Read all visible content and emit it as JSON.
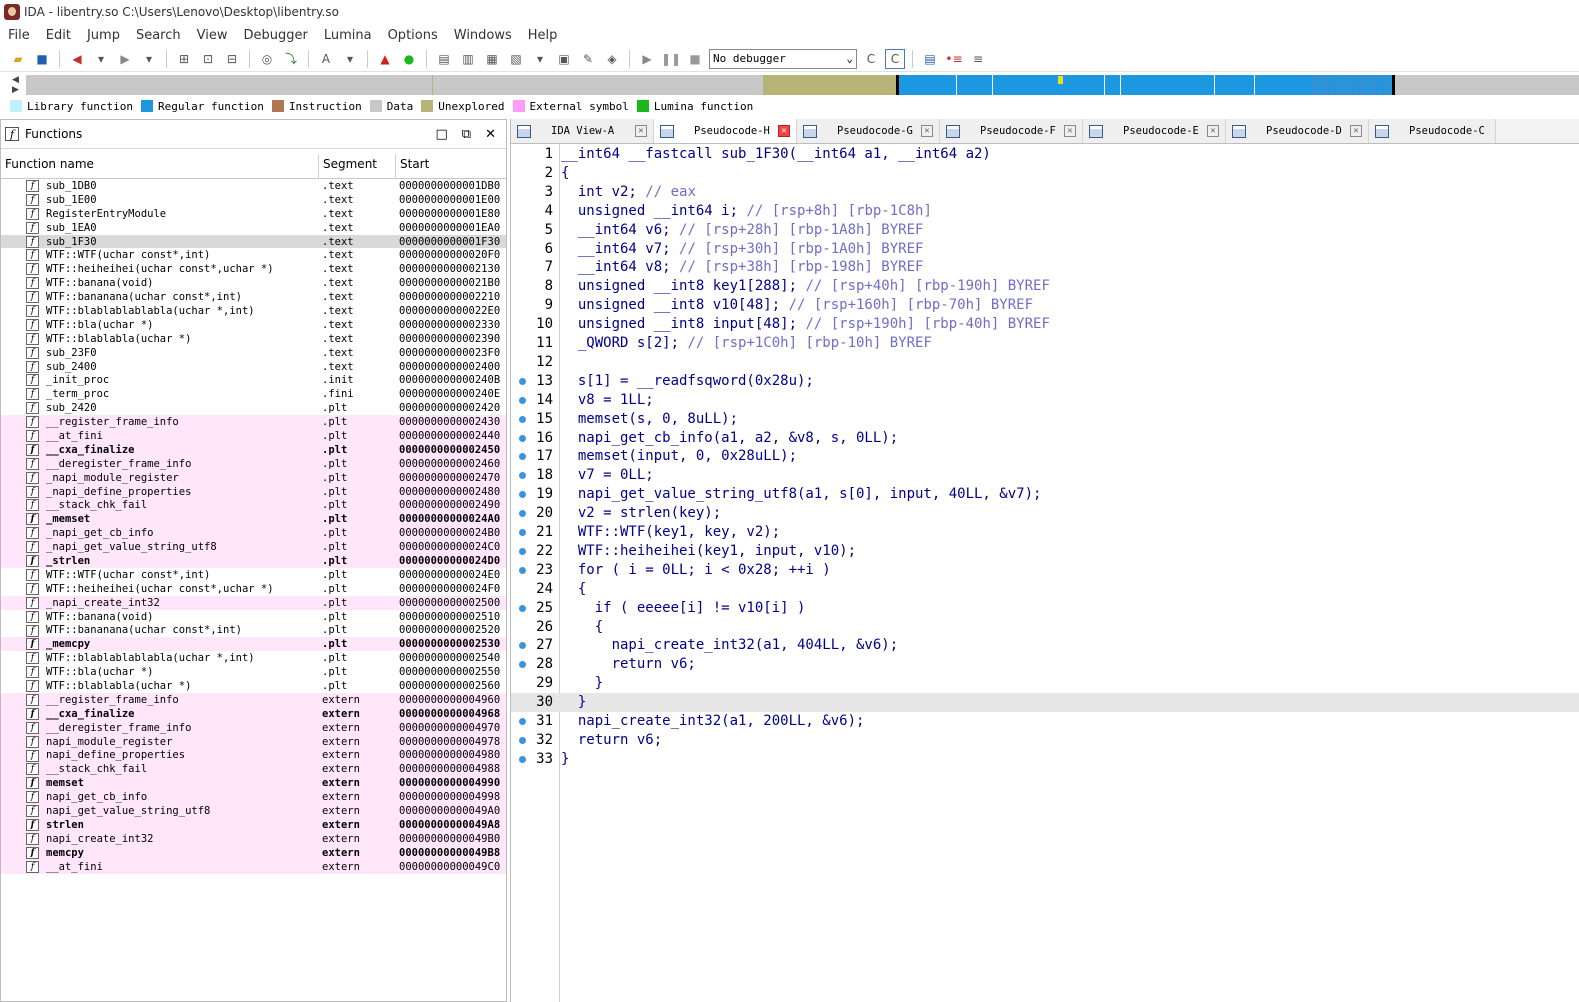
{
  "window": {
    "title": "IDA - libentry.so C:\\Users\\Lenovo\\Desktop\\libentry.so"
  },
  "menu": [
    "File",
    "Edit",
    "Jump",
    "Search",
    "View",
    "Debugger",
    "Lumina",
    "Options",
    "Windows",
    "Help"
  ],
  "toolbar": {
    "debugger_label": "No debugger"
  },
  "legend": [
    {
      "label": "Library function",
      "color": "#c0f0ff"
    },
    {
      "label": "Regular function",
      "color": "#1c98e0"
    },
    {
      "label": "Instruction",
      "color": "#b07850"
    },
    {
      "label": "Data",
      "color": "#c8c8c8"
    },
    {
      "label": "Unexplored",
      "color": "#b8b478"
    },
    {
      "label": "External symbol",
      "color": "#ff9cf8"
    },
    {
      "label": "Lumina function",
      "color": "#1ab81a"
    }
  ],
  "functions_panel": {
    "title": "Functions",
    "columns": [
      "Function name",
      "Segment",
      "Start"
    ],
    "rows": [
      {
        "name": "sub_1DB0",
        "seg": ".text",
        "start": "0000000000001DB0"
      },
      {
        "name": "sub_1E00",
        "seg": ".text",
        "start": "0000000000001E00"
      },
      {
        "name": "RegisterEntryModule",
        "seg": ".text",
        "start": "0000000000001E80"
      },
      {
        "name": "sub_1EA0",
        "seg": ".text",
        "start": "0000000000001EA0"
      },
      {
        "name": "sub_1F30",
        "seg": ".text",
        "start": "0000000000001F30"
      },
      {
        "name": "WTF::WTF(uchar const*,int)",
        "seg": ".text",
        "start": "00000000000020F0"
      },
      {
        "name": "WTF::heiheihei(uchar const*,uchar *)",
        "seg": ".text",
        "start": "0000000000002130"
      },
      {
        "name": "WTF::banana(void)",
        "seg": ".text",
        "start": "00000000000021B0"
      },
      {
        "name": "WTF::bananana(uchar const*,int)",
        "seg": ".text",
        "start": "0000000000002210"
      },
      {
        "name": "WTF::blablablablabla(uchar *,int)",
        "seg": ".text",
        "start": "00000000000022E0"
      },
      {
        "name": "WTF::bla(uchar *)",
        "seg": ".text",
        "start": "0000000000002330"
      },
      {
        "name": "WTF::blablabla(uchar *)",
        "seg": ".text",
        "start": "0000000000002390"
      },
      {
        "name": "sub_23F0",
        "seg": ".text",
        "start": "00000000000023F0"
      },
      {
        "name": "sub_2400",
        "seg": ".text",
        "start": "0000000000002400"
      },
      {
        "name": "_init_proc",
        "seg": ".init",
        "start": "000000000000240B"
      },
      {
        "name": "_term_proc",
        "seg": ".fini",
        "start": "000000000000240E"
      },
      {
        "name": "sub_2420",
        "seg": ".plt",
        "start": "0000000000002420"
      },
      {
        "name": "__register_frame_info",
        "seg": ".plt",
        "start": "0000000000002430"
      },
      {
        "name": "__at_fini",
        "seg": ".plt",
        "start": "0000000000002440"
      },
      {
        "name": "__cxa_finalize",
        "seg": ".plt",
        "start": "0000000000002450"
      },
      {
        "name": "__deregister_frame_info",
        "seg": ".plt",
        "start": "0000000000002460"
      },
      {
        "name": "_napi_module_register",
        "seg": ".plt",
        "start": "0000000000002470"
      },
      {
        "name": "_napi_define_properties",
        "seg": ".plt",
        "start": "0000000000002480"
      },
      {
        "name": "__stack_chk_fail",
        "seg": ".plt",
        "start": "0000000000002490"
      },
      {
        "name": "_memset",
        "seg": ".plt",
        "start": "00000000000024A0"
      },
      {
        "name": "_napi_get_cb_info",
        "seg": ".plt",
        "start": "00000000000024B0"
      },
      {
        "name": "_napi_get_value_string_utf8",
        "seg": ".plt",
        "start": "00000000000024C0"
      },
      {
        "name": "_strlen",
        "seg": ".plt",
        "start": "00000000000024D0"
      },
      {
        "name": "WTF::WTF(uchar const*,int)",
        "seg": ".plt",
        "start": "00000000000024E0"
      },
      {
        "name": "WTF::heiheihei(uchar const*,uchar *)",
        "seg": ".plt",
        "start": "00000000000024F0"
      },
      {
        "name": "_napi_create_int32",
        "seg": ".plt",
        "start": "0000000000002500"
      },
      {
        "name": "WTF::banana(void)",
        "seg": ".plt",
        "start": "0000000000002510"
      },
      {
        "name": "WTF::bananana(uchar const*,int)",
        "seg": ".plt",
        "start": "0000000000002520"
      },
      {
        "name": "_memcpy",
        "seg": ".plt",
        "start": "0000000000002530"
      },
      {
        "name": "WTF::blablablablabla(uchar *,int)",
        "seg": ".plt",
        "start": "0000000000002540"
      },
      {
        "name": "WTF::bla(uchar *)",
        "seg": ".plt",
        "start": "0000000000002550"
      },
      {
        "name": "WTF::blablabla(uchar *)",
        "seg": ".plt",
        "start": "0000000000002560"
      },
      {
        "name": "__register_frame_info",
        "seg": "extern",
        "start": "0000000000004960"
      },
      {
        "name": "__cxa_finalize",
        "seg": "extern",
        "start": "0000000000004968"
      },
      {
        "name": "__deregister_frame_info",
        "seg": "extern",
        "start": "0000000000004970"
      },
      {
        "name": "napi_module_register",
        "seg": "extern",
        "start": "0000000000004978"
      },
      {
        "name": "napi_define_properties",
        "seg": "extern",
        "start": "0000000000004980"
      },
      {
        "name": "__stack_chk_fail",
        "seg": "extern",
        "start": "0000000000004988"
      },
      {
        "name": "memset",
        "seg": "extern",
        "start": "0000000000004990"
      },
      {
        "name": "napi_get_cb_info",
        "seg": "extern",
        "start": "0000000000004998"
      },
      {
        "name": "napi_get_value_string_utf8",
        "seg": "extern",
        "start": "00000000000049A0"
      },
      {
        "name": "strlen",
        "seg": "extern",
        "start": "00000000000049A8"
      },
      {
        "name": "napi_create_int32",
        "seg": "extern",
        "start": "00000000000049B0"
      },
      {
        "name": "memcpy",
        "seg": "extern",
        "start": "00000000000049B8"
      },
      {
        "name": "__at_fini",
        "seg": "extern",
        "start": "00000000000049C0"
      }
    ]
  },
  "tabs": [
    "IDA View-A",
    "Pseudocode-H",
    "Pseudocode-G",
    "Pseudocode-F",
    "Pseudocode-E",
    "Pseudocode-D",
    "Pseudocode-C"
  ],
  "code_lines": [
    {
      "n": "1",
      "t": "__int64 __fastcall sub_1F30(__int64 a1, __int64 a2)"
    },
    {
      "n": "2",
      "t": "{"
    },
    {
      "n": "3",
      "t": "  int v2; // eax"
    },
    {
      "n": "4",
      "t": "  unsigned __int64 i; // [rsp+8h] [rbp-1C8h]"
    },
    {
      "n": "5",
      "t": "  __int64 v6; // [rsp+28h] [rbp-1A8h] BYREF"
    },
    {
      "n": "6",
      "t": "  __int64 v7; // [rsp+30h] [rbp-1A0h] BYREF"
    },
    {
      "n": "7",
      "t": "  __int64 v8; // [rsp+38h] [rbp-198h] BYREF"
    },
    {
      "n": "8",
      "t": "  unsigned __int8 key1[288]; // [rsp+40h] [rbp-190h] BYREF"
    },
    {
      "n": "9",
      "t": "  unsigned __int8 v10[48]; // [rsp+160h] [rbp-70h] BYREF"
    },
    {
      "n": "10",
      "t": "  unsigned __int8 input[48]; // [rsp+190h] [rbp-40h] BYREF"
    },
    {
      "n": "11",
      "t": "  _QWORD s[2]; // [rsp+1C0h] [rbp-10h] BYREF"
    },
    {
      "n": "12",
      "t": ""
    },
    {
      "n": "13",
      "t": "  s[1] = __readfsqword(0x28u);"
    },
    {
      "n": "14",
      "t": "  v8 = 1LL;"
    },
    {
      "n": "15",
      "t": "  memset(s, 0, 8uLL);"
    },
    {
      "n": "16",
      "t": "  napi_get_cb_info(a1, a2, &v8, s, 0LL);"
    },
    {
      "n": "17",
      "t": "  memset(input, 0, 0x28uLL);"
    },
    {
      "n": "18",
      "t": "  v7 = 0LL;"
    },
    {
      "n": "19",
      "t": "  napi_get_value_string_utf8(a1, s[0], input, 40LL, &v7);"
    },
    {
      "n": "20",
      "t": "  v2 = strlen(key);"
    },
    {
      "n": "21",
      "t": "  WTF::WTF(key1, key, v2);"
    },
    {
      "n": "22",
      "t": "  WTF::heiheihei(key1, input, v10);"
    },
    {
      "n": "23",
      "t": "  for ( i = 0LL; i < 0x28; ++i )"
    },
    {
      "n": "24",
      "t": "  {"
    },
    {
      "n": "25",
      "t": "    if ( eeeee[i] != v10[i] )"
    },
    {
      "n": "26",
      "t": "    {"
    },
    {
      "n": "27",
      "t": "      napi_create_int32(a1, 404LL, &v6);"
    },
    {
      "n": "28",
      "t": "      return v6;"
    },
    {
      "n": "29",
      "t": "    }"
    },
    {
      "n": "30",
      "t": "  }"
    },
    {
      "n": "31",
      "t": "  napi_create_int32(a1, 200LL, &v6);"
    },
    {
      "n": "32",
      "t": "  return v6;"
    },
    {
      "n": "33",
      "t": "}"
    }
  ]
}
